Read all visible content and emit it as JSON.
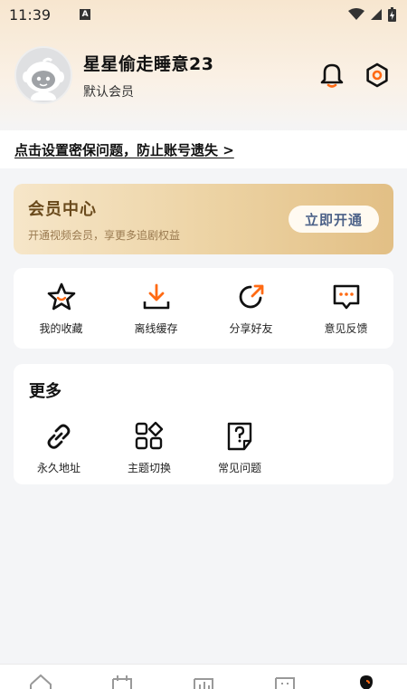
{
  "status_bar": {
    "time": "11:39",
    "notification_badge": "A",
    "icons": [
      "wifi-icon",
      "signal-icon",
      "battery-icon"
    ]
  },
  "profile": {
    "username": "星星偷走睡意23",
    "member_status": "默认会员",
    "icons": [
      "bell-icon",
      "settings-icon"
    ]
  },
  "security_prompt": "点击设置密保问题，防止账号遗失 >",
  "vip": {
    "title": "会员中心",
    "subtitle": "开通视频会员，享更多追剧权益",
    "button": "立即开通"
  },
  "quick_actions": [
    {
      "label": "我的收藏",
      "icon": "star-icon"
    },
    {
      "label": "离线缓存",
      "icon": "download-icon"
    },
    {
      "label": "分享好友",
      "icon": "share-icon"
    },
    {
      "label": "意见反馈",
      "icon": "feedback-icon"
    }
  ],
  "more": {
    "title": "更多",
    "items": [
      {
        "label": "永久地址",
        "icon": "link-icon"
      },
      {
        "label": "主题切换",
        "icon": "theme-grid-icon"
      },
      {
        "label": "常见问题",
        "icon": "faq-icon"
      }
    ]
  },
  "bottom_nav": {
    "items": [
      "home-icon",
      "calendar-icon",
      "chart-icon",
      "tv-icon",
      "profile-icon"
    ],
    "active_index": 4
  },
  "colors": {
    "accent": "#ff6a13",
    "vip_gold": "#e2bf85",
    "vip_button_text": "#4b6188"
  }
}
